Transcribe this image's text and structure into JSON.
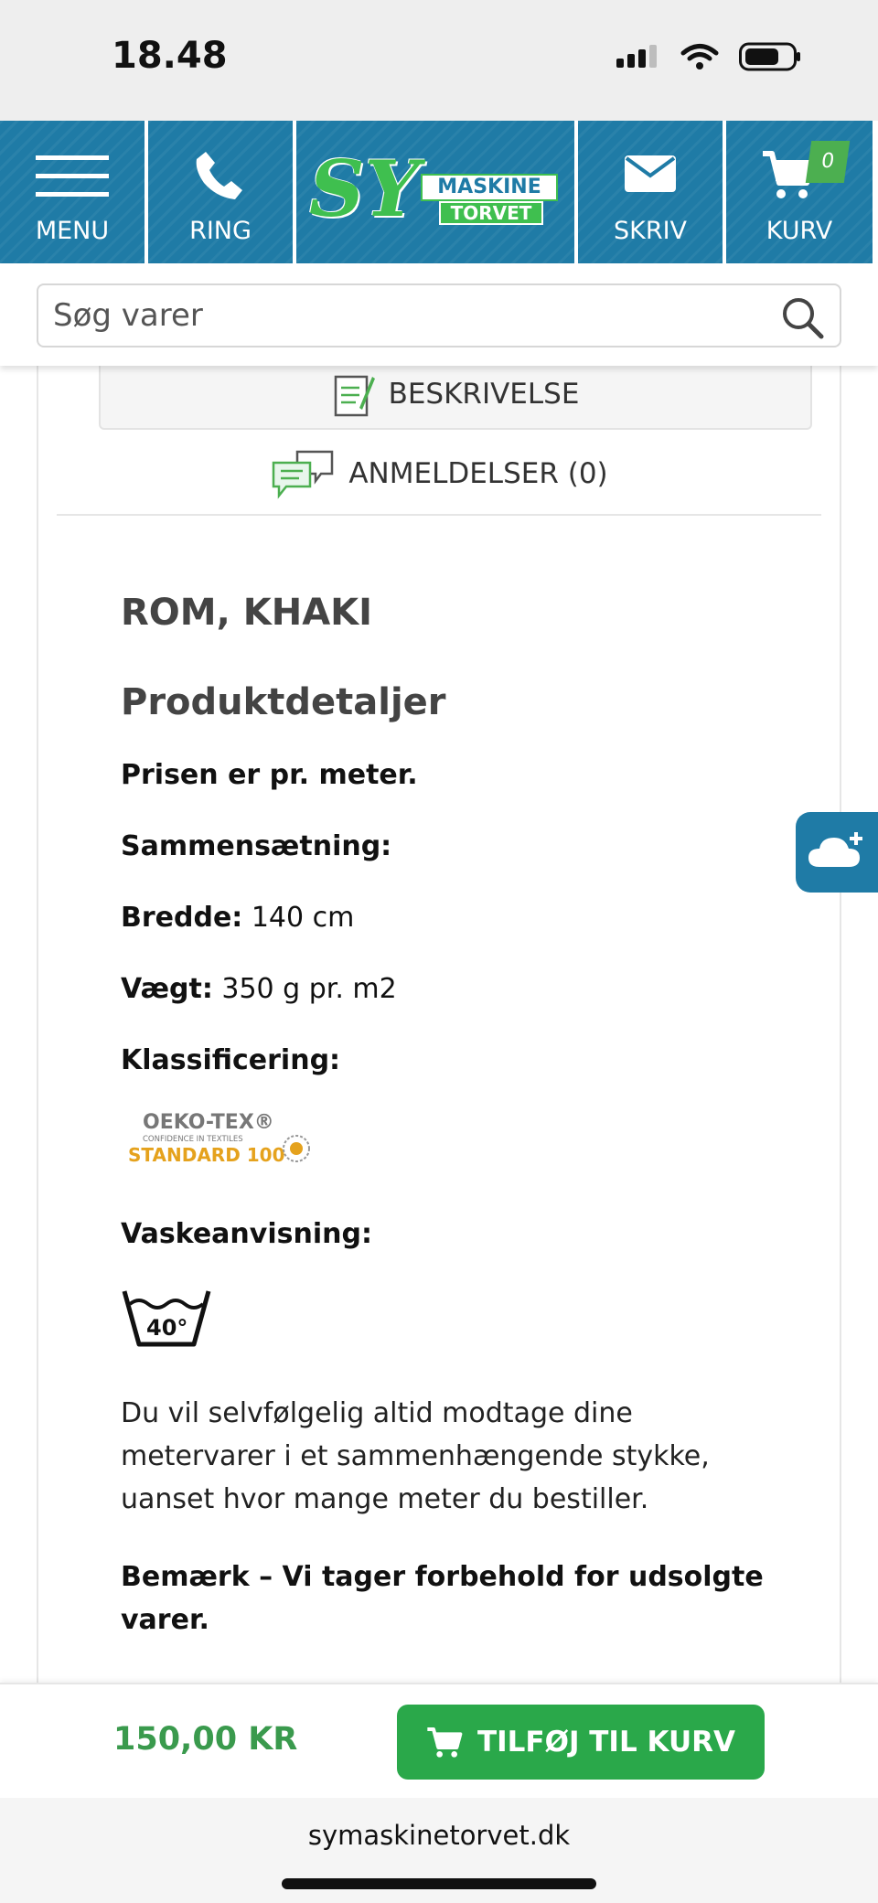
{
  "status_bar": {
    "time": "18.48"
  },
  "nav": {
    "menu_label": "MENU",
    "ring_label": "RING",
    "logo_sy": "SY",
    "logo_line1": "MASKINE",
    "logo_line2": "TORVET",
    "skriv_label": "SKRIV",
    "kurv_label": "KURV",
    "cart_count": "0"
  },
  "search": {
    "placeholder": "Søg varer"
  },
  "tabs": {
    "description_label": "BESKRIVELSE",
    "reviews_label": "ANMELDELSER (0)"
  },
  "product": {
    "title": "ROM, KHAKI",
    "details_heading": "Produktdetaljer",
    "price_note": "Prisen er pr. meter.",
    "composition_label": "Sammensætning:",
    "width_label": "Bredde:",
    "width_value": " 140 cm",
    "weight_label": "Vægt:",
    "weight_value": " 350 g pr. m2",
    "classification_label": "Klassificering:",
    "oeko_line1": "OEKO-TEX®",
    "oeko_line2": "CONFIDENCE IN TEXTILES",
    "oeko_line3": "STANDARD 100",
    "wash_label": "Vaskeanvisning:",
    "wash_temp": "40°",
    "body_text": "Du vil selvfølgelig altid modtage dine metervarer i et sammenhængende stykke, uanset hvor mange meter du bestiller.",
    "note_text": "Bemærk – Vi tager forbehold for udsolgte varer."
  },
  "purchase": {
    "price": "150,00 KR",
    "add_to_cart_label": "TILFØJ TIL KURV"
  },
  "browser": {
    "url": "symaskinetorvet.dk"
  },
  "colors": {
    "nav_blue": "#1f7ba6",
    "brand_green": "#2aa84a",
    "price_green": "#3a9a4d",
    "oeko_orange": "#e5a21d"
  },
  "icons": [
    "hamburger-icon",
    "phone-icon",
    "envelope-icon",
    "cart-icon",
    "search-icon",
    "document-icon",
    "chat-bubbles-icon",
    "cloud-add-icon",
    "oeko-tex-logo",
    "wash-40-icon"
  ]
}
